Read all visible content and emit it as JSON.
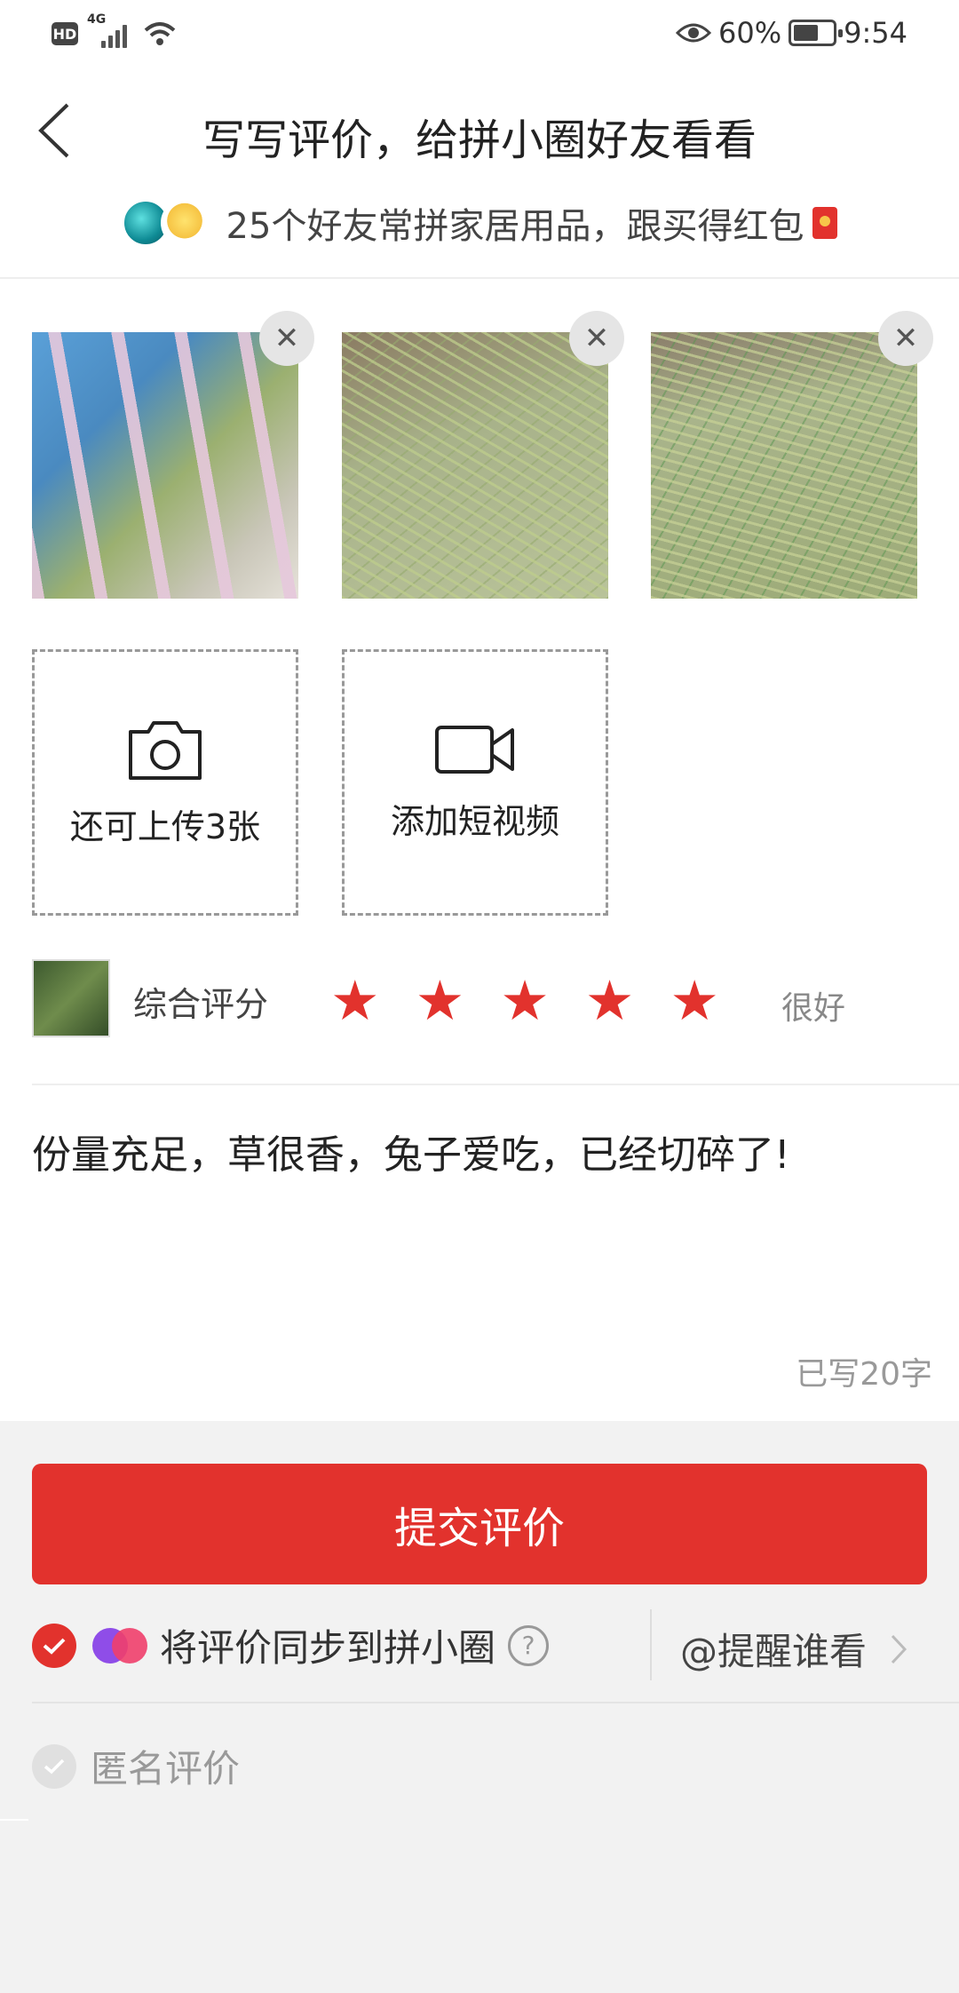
{
  "status_bar": {
    "hd": "HD",
    "network": "4G",
    "battery": "60%",
    "time": "9:54"
  },
  "header": {
    "title": "写写评价，给拼小圈好友看看",
    "friends_text": "25个好友常拼家居用品，跟买得红包"
  },
  "photos": [
    {
      "name": "rabbit-cage-hay-photo"
    },
    {
      "name": "hay-bag-photo"
    },
    {
      "name": "hay-bag-label-photo"
    }
  ],
  "upload": {
    "photo_label": "还可上传3张",
    "video_label": "添加短视频"
  },
  "rating": {
    "label": "综合评分",
    "stars": 5,
    "max_stars": 5,
    "text": "很好",
    "star_color": "#e2322d"
  },
  "review": {
    "text": "份量充足，草很香，兔子爱吃，已经切碎了!",
    "count": "已写20字"
  },
  "actions": {
    "submit_label": "提交评价",
    "sync_label": "将评价同步到拼小圈",
    "help_symbol": "?",
    "mention_label": "@提醒谁看",
    "anonymous_label": "匿名评价"
  },
  "colors": {
    "accent": "#e2322d",
    "background": "#f2f2f2"
  },
  "icons": [
    "back-arrow-icon",
    "close-icon",
    "camera-icon",
    "video-camera-icon",
    "star-icon",
    "check-icon",
    "help-icon",
    "chevron-right-icon",
    "red-packet-icon",
    "eye-icon",
    "wifi-icon",
    "battery-icon"
  ]
}
